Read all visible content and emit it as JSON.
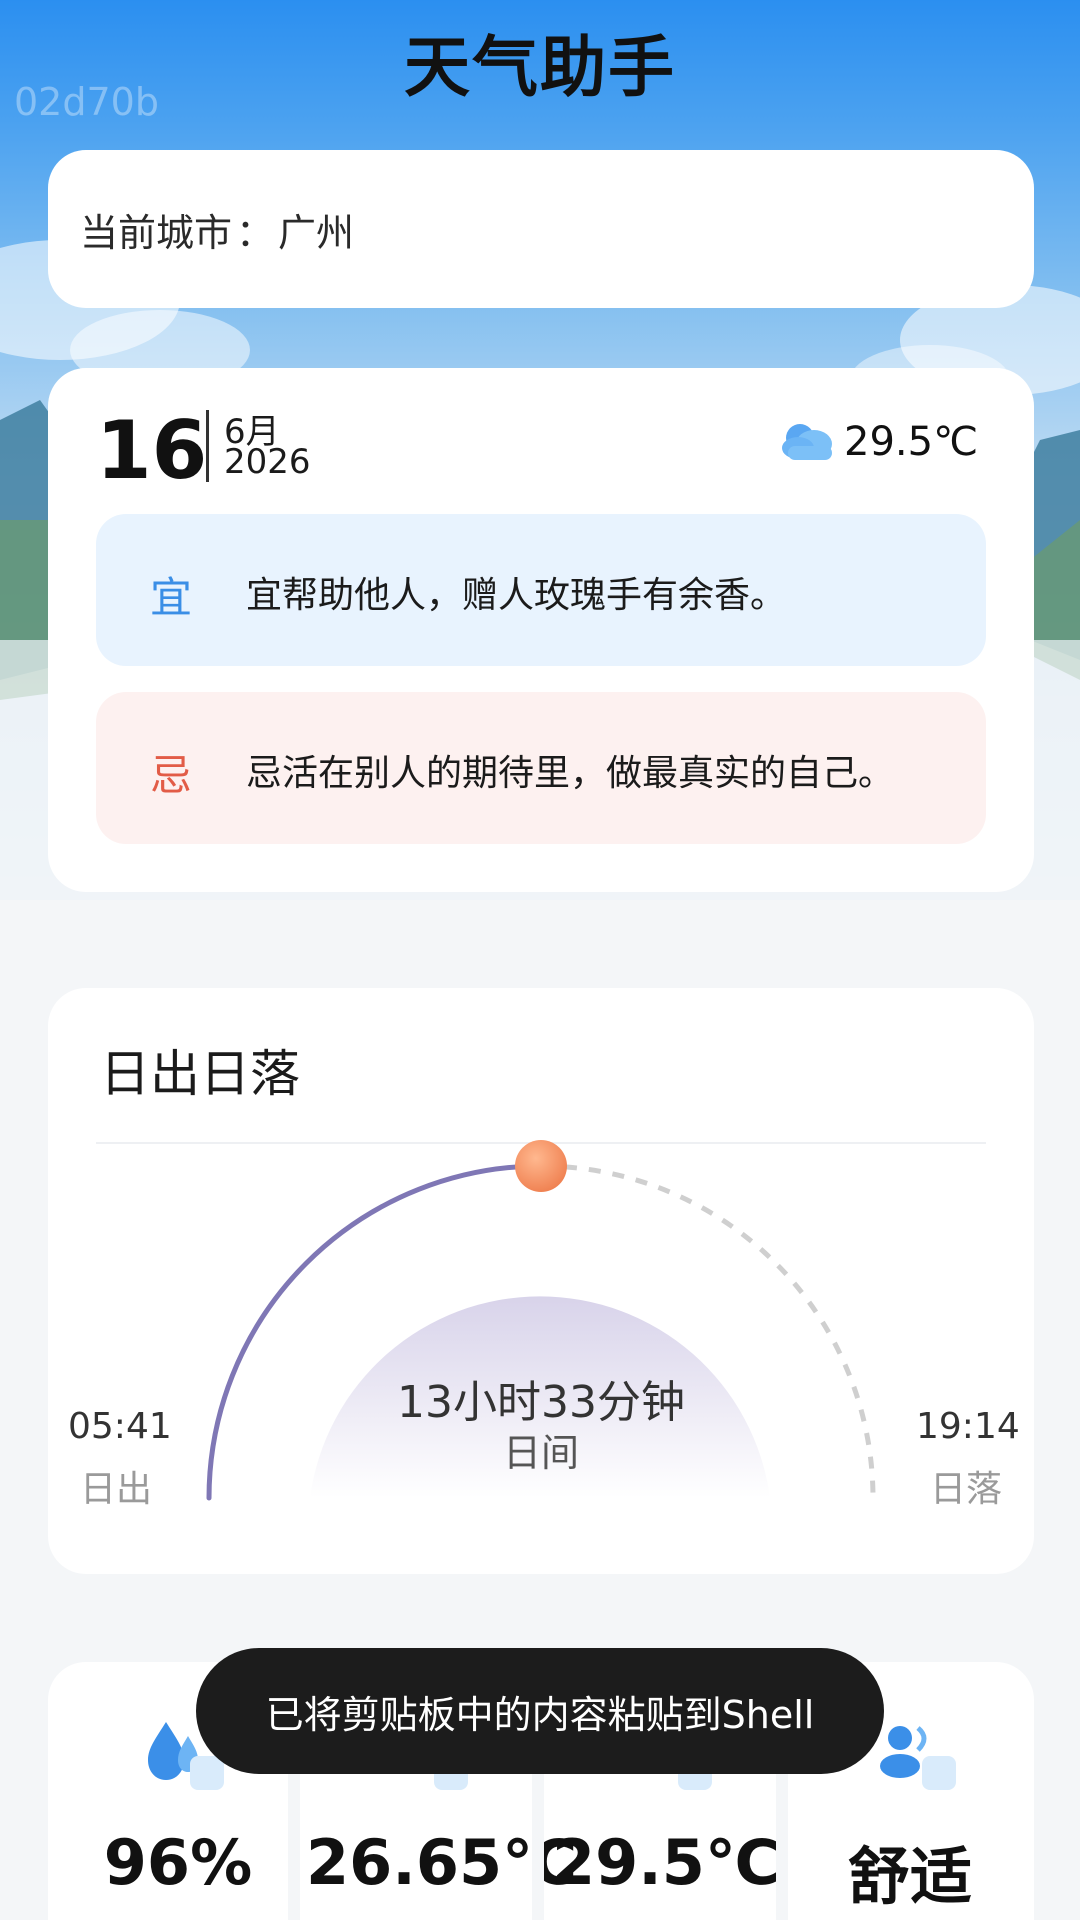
{
  "app": {
    "title": "天气助手",
    "watermark": "02d70b"
  },
  "city": {
    "label": "当前城市",
    "separator": "：",
    "name": "广州"
  },
  "date": {
    "day": "16",
    "month": "6月",
    "year": "2026",
    "weather_icon": "cloud-icon",
    "temperature": "29.5℃"
  },
  "almanac": {
    "yi_tag": "宜",
    "yi_text": "宜帮助他人，赠人玫瑰手有余香。",
    "ji_tag": "忌",
    "ji_text": "忌活在别人的期待里，做最真实的自己。"
  },
  "sun": {
    "title": "日出日落",
    "day_length": "13小时33分钟",
    "day_length_label": "日间",
    "sunrise_time": "05:41",
    "sunrise_label": "日出",
    "sunset_time": "19:14",
    "sunset_label": "日落",
    "progress_fraction": 0.5
  },
  "stats": {
    "items": [
      {
        "icon": "humidity-icon",
        "value": "96%"
      },
      {
        "icon": "temperature-icon",
        "value": "26.65℃"
      },
      {
        "icon": "feels-like-icon",
        "value": "29.5℃"
      },
      {
        "icon": "comfort-icon",
        "value": "舒适"
      }
    ]
  },
  "toast": {
    "message": "已将剪贴板中的内容粘贴到Shell"
  },
  "colors": {
    "yi_accent": "#3a8ee6",
    "ji_accent": "#e25c47",
    "sun_arc": "#7f77b5",
    "sun_ball": "#f08a5d"
  }
}
